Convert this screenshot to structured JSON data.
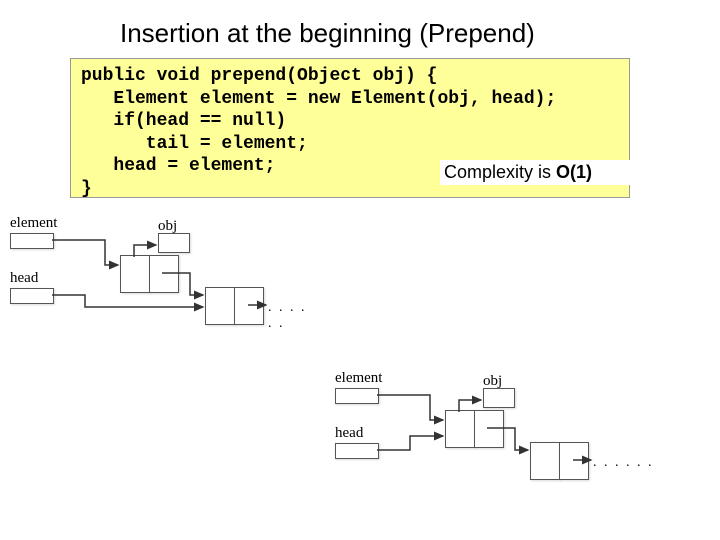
{
  "title": "Insertion at the beginning (Prepend)",
  "code": "public void prepend(Object obj) {\n   Element element = new Element(obj, head);\n   if(head == null)\n      tail = element;\n   head = element;\n}",
  "complexity_prefix": "Complexity is",
  "complexity_value": "O(1)",
  "labels": {
    "element": "element",
    "head": "head",
    "obj": "obj"
  },
  "dots": ". . . . . ."
}
